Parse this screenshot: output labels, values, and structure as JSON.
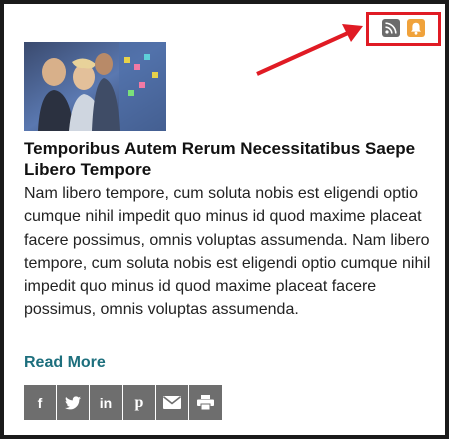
{
  "article": {
    "title": "Temporibus Autem Rerum Necessitatibus Saepe Libero Tempore",
    "excerpt": "Nam libero tempore, cum soluta nobis est eligendi optio cumque nihil impedit quo minus id quod maxime placeat facere possimus, omnis voluptas assumenda. Nam libero tempore, cum soluta nobis est eligendi optio cumque nihil impedit quo minus id quod maxime placeat facere possimus, omnis voluptas assumenda.",
    "read_more_label": "Read More"
  },
  "feed_icons": [
    {
      "icon": "rss-icon",
      "color": "#6b6b6b"
    },
    {
      "icon": "bell-icon",
      "color": "#f0a23b"
    }
  ],
  "highlight_color": "#e01b24",
  "share_buttons": [
    {
      "icon": "facebook-icon",
      "glyph": "f"
    },
    {
      "icon": "twitter-icon"
    },
    {
      "icon": "linkedin-icon",
      "glyph": "in"
    },
    {
      "icon": "pinterest-icon",
      "glyph": "p"
    },
    {
      "icon": "email-icon"
    },
    {
      "icon": "print-icon"
    }
  ]
}
